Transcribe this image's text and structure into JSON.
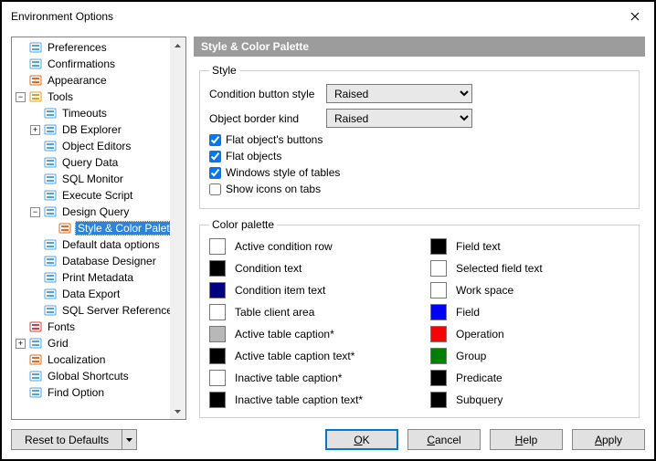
{
  "title": "Environment Options",
  "tree": [
    {
      "label": "Preferences",
      "depth": 0,
      "icon": "pref",
      "toggle": ""
    },
    {
      "label": "Confirmations",
      "depth": 0,
      "icon": "conf",
      "toggle": ""
    },
    {
      "label": "Appearance",
      "depth": 0,
      "icon": "appear",
      "toggle": ""
    },
    {
      "label": "Tools",
      "depth": 0,
      "icon": "tools",
      "toggle": "-"
    },
    {
      "label": "Timeouts",
      "depth": 1,
      "icon": "timeout",
      "toggle": ""
    },
    {
      "label": "DB Explorer",
      "depth": 1,
      "icon": "dbexp",
      "toggle": "+"
    },
    {
      "label": "Object Editors",
      "depth": 1,
      "icon": "objed",
      "toggle": ""
    },
    {
      "label": "Query Data",
      "depth": 1,
      "icon": "qdata",
      "toggle": ""
    },
    {
      "label": "SQL Monitor",
      "depth": 1,
      "icon": "sqlmon",
      "toggle": ""
    },
    {
      "label": "Execute Script",
      "depth": 1,
      "icon": "exec",
      "toggle": ""
    },
    {
      "label": "Design Query",
      "depth": 1,
      "icon": "design",
      "toggle": "-"
    },
    {
      "label": "Style & Color Palette",
      "depth": 2,
      "icon": "palette",
      "toggle": "",
      "selected": true
    },
    {
      "label": "Default data options",
      "depth": 1,
      "icon": "ddo",
      "toggle": ""
    },
    {
      "label": "Database Designer",
      "depth": 1,
      "icon": "dbdes",
      "toggle": ""
    },
    {
      "label": "Print Metadata",
      "depth": 1,
      "icon": "print",
      "toggle": ""
    },
    {
      "label": "Data Export",
      "depth": 1,
      "icon": "export",
      "toggle": ""
    },
    {
      "label": "SQL Server Reference",
      "depth": 1,
      "icon": "sqlref",
      "toggle": ""
    },
    {
      "label": "Fonts",
      "depth": 0,
      "icon": "fonts",
      "toggle": ""
    },
    {
      "label": "Grid",
      "depth": 0,
      "icon": "grid",
      "toggle": "+"
    },
    {
      "label": "Localization",
      "depth": 0,
      "icon": "loc",
      "toggle": ""
    },
    {
      "label": "Global Shortcuts",
      "depth": 0,
      "icon": "shortcut",
      "toggle": ""
    },
    {
      "label": "Find Option",
      "depth": 0,
      "icon": "find",
      "toggle": ""
    }
  ],
  "panel": {
    "title": "Style & Color Palette",
    "styleGroup": {
      "legend": "Style",
      "conditionStyleLabel": "Condition button style",
      "conditionStyleValue": "Raised",
      "borderKindLabel": "Object border kind",
      "borderKindValue": "Raised",
      "flatButtons": {
        "label": "Flat object's buttons",
        "checked": true
      },
      "flatObjects": {
        "label": "Flat objects",
        "checked": true
      },
      "winTables": {
        "label": "Windows style of tables",
        "checked": true
      },
      "showIcons": {
        "label": "Show icons on tabs",
        "checked": false
      }
    },
    "paletteGroup": {
      "legend": "Color palette",
      "left": [
        {
          "label": "Active condition row",
          "color": "#ffffff"
        },
        {
          "label": "Condition text",
          "color": "#000000"
        },
        {
          "label": "Condition item text",
          "color": "#000080"
        },
        {
          "label": "Table client area",
          "color": "#ffffff"
        },
        {
          "label": "Active table caption*",
          "color": "#b8b8b8"
        },
        {
          "label": "Active table caption text*",
          "color": "#000000"
        },
        {
          "label": "Inactive table caption*",
          "color": "#ffffff"
        },
        {
          "label": "Inactive table caption text*",
          "color": "#000000"
        }
      ],
      "right": [
        {
          "label": "Field text",
          "color": "#000000"
        },
        {
          "label": "Selected field text",
          "color": "#ffffff"
        },
        {
          "label": "Work space",
          "color": "#ffffff"
        },
        {
          "label": "Field",
          "color": "#0000ff"
        },
        {
          "label": "Operation",
          "color": "#ff0000"
        },
        {
          "label": "Group",
          "color": "#008000"
        },
        {
          "label": "Predicate",
          "color": "#000000"
        },
        {
          "label": "Subquery",
          "color": "#000000"
        }
      ]
    }
  },
  "footer": {
    "reset": "Reset to Defaults",
    "ok": "OK",
    "cancel": "Cancel",
    "help": "Help",
    "apply": "Apply"
  },
  "icons": {
    "pref": "#4fa3e3",
    "conf": "#4fa3e3",
    "appear": "#e06b1f",
    "tools": "#e0a01f",
    "timeout": "#4fa3e3",
    "dbexp": "#4fa3e3",
    "objed": "#4fa3e3",
    "qdata": "#4fa3e3",
    "sqlmon": "#4fa3e3",
    "exec": "#4fa3e3",
    "design": "#4fa3e3",
    "palette": "#e06b1f",
    "ddo": "#4fa3e3",
    "dbdes": "#4fa3e3",
    "print": "#4fa3e3",
    "export": "#4fa3e3",
    "sqlref": "#4fa3e3",
    "fonts": "#d04040",
    "grid": "#4fa3e3",
    "loc": "#e06b1f",
    "shortcut": "#4fa3e3",
    "find": "#4fa3e3"
  }
}
